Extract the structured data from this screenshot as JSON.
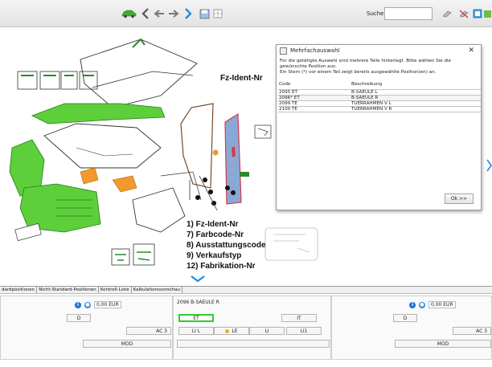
{
  "toolbar": {
    "search_label": "Suche:",
    "search_value": "",
    "colors": {
      "nav": "#1e8be0",
      "car_green": "#44aa33"
    }
  },
  "canvas": {
    "fz_ident_label": "Fz-Ident-Nr",
    "legend": [
      "1) Fz-Ident-Nr",
      "7) Farbcode-Nr",
      "8) Ausstattungscode",
      "9) Verkaufstyp",
      "12) Fabrikation-Nr"
    ]
  },
  "dialog": {
    "title": "Mehrfachauswahl",
    "text": [
      "Für die getätigte Auswahl sind mehrere Teile hinterlegt. Bitte wählen Sie die",
      "gewünschte Position aus.",
      "Ein Stern (*) vor einem Teil zeigt bereits ausgewählte Position(en) an."
    ],
    "columns": [
      "Code",
      "Beschreibung"
    ],
    "rows": [
      {
        "code": "2095 ET",
        "desc": "B-SAEULE L"
      },
      {
        "code": "2096* ET",
        "desc": "B-SAEULE R"
      },
      {
        "code": "2099 TE",
        "desc": "TUERRAHMEN V L"
      },
      {
        "code": "2100 TE",
        "desc": "TUERRAHMEN V R"
      }
    ],
    "ok_label": "Ok >>"
  },
  "tabs": [
    "dardpositionen",
    "Nicht-Standard-Positionen",
    "Kontroll-Liste",
    "Kalkulationsvorschau"
  ],
  "panels": {
    "left": {
      "amount": "0,00 EUR",
      "btn_d": "D",
      "btn_ac3": "AC 3",
      "btn_mod": "MOD"
    },
    "middle": {
      "part_title": "2096 B-SAEULE R",
      "btn_et": "ET",
      "btn_it": "IT",
      "btn_ll": "LI L",
      "btn_le": "LE",
      "btn_li": "LI",
      "btn_li1": "LI1"
    },
    "right": {
      "amount": "0,00 EUR",
      "btn_d": "D",
      "btn_ac3": "AC 3",
      "btn_mod": "MOD"
    }
  }
}
